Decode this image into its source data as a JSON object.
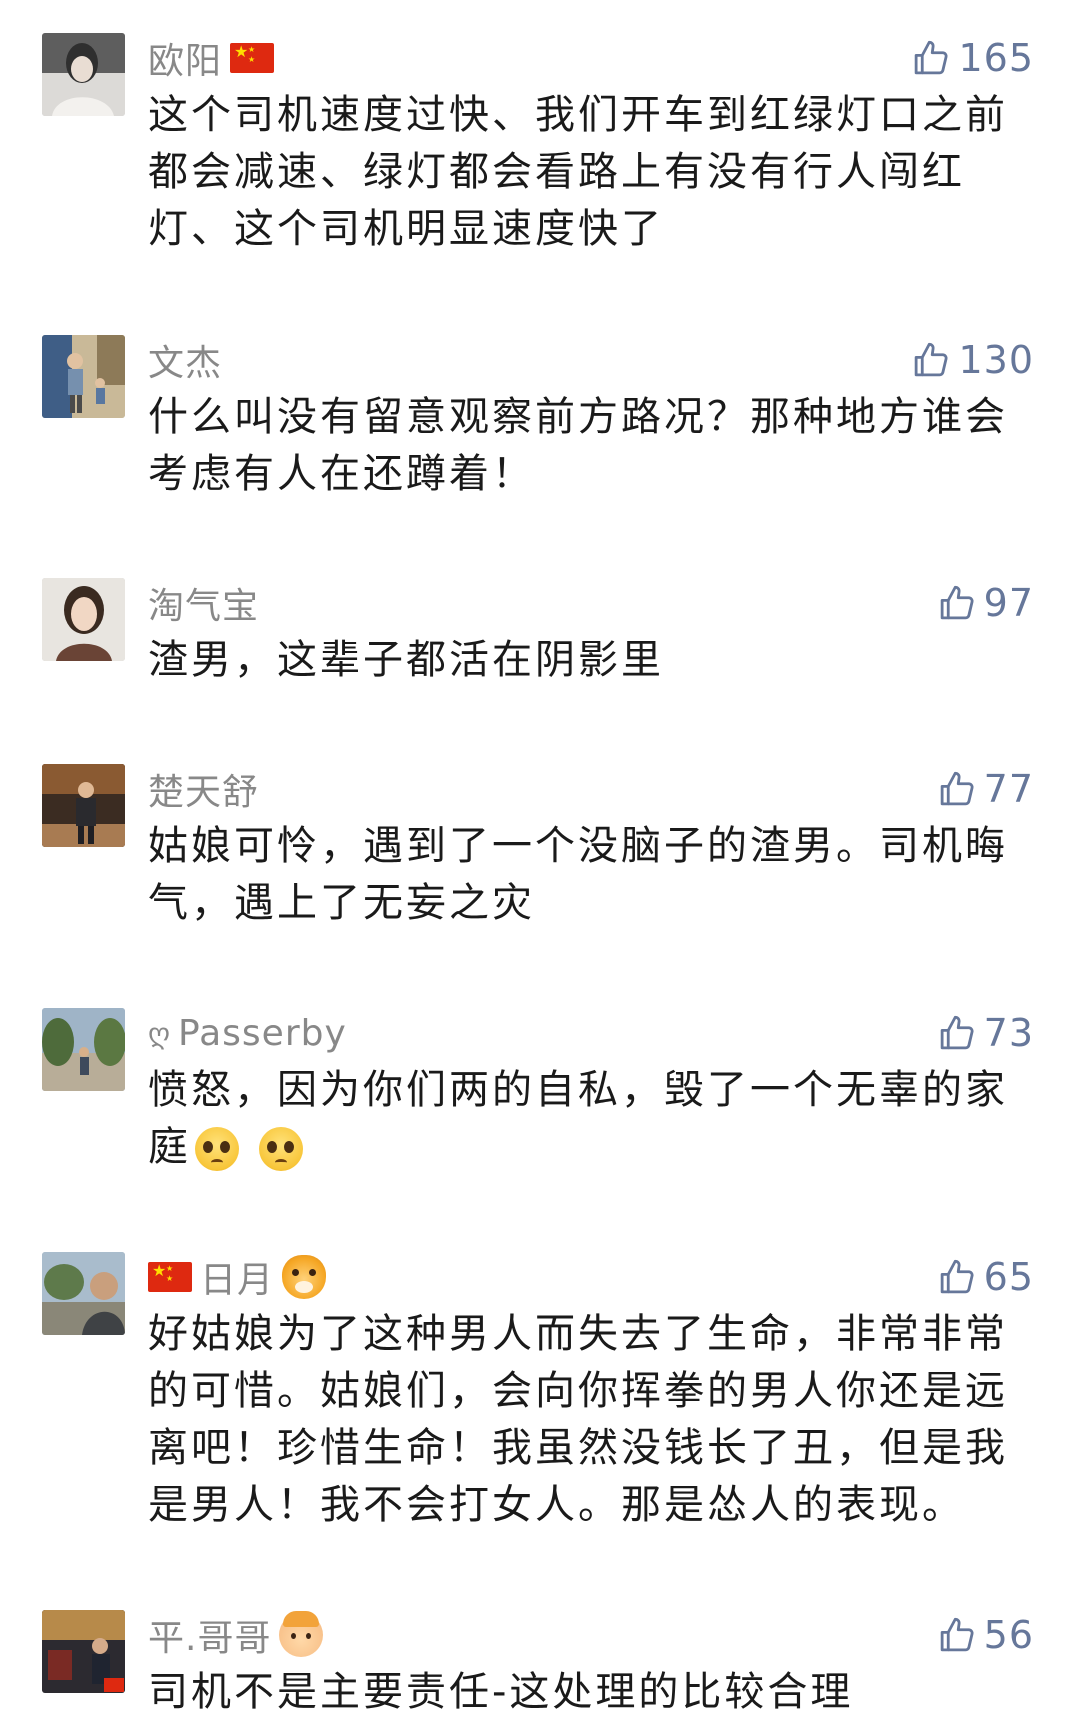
{
  "comments": [
    {
      "username": "欧阳",
      "likes": "165",
      "text": "这个司机速度过快、我们开车到红绿灯口之前都会减速、绿灯都会看路上有没有行人闯红灯、这个司机明显速度快了",
      "name_prefix_icon": "",
      "name_suffix_icon": "china-flag-icon",
      "avatar_colors": [
        "#6b6b6b",
        "#e8e6e4"
      ]
    },
    {
      "username": "文杰",
      "likes": "130",
      "text": "什么叫没有留意观察前方路况？那种地方谁会考虑有人在还蹲着！",
      "name_prefix_icon": "",
      "name_suffix_icon": "",
      "avatar_colors": [
        "#4d6b8a",
        "#c6b28c"
      ]
    },
    {
      "username": "淘气宝",
      "likes": "97",
      "text": "渣男，这辈子都活在阴影里",
      "name_prefix_icon": "",
      "name_suffix_icon": "",
      "avatar_colors": [
        "#e4e0da",
        "#7a5a45"
      ]
    },
    {
      "username": "楚天舒",
      "likes": "77",
      "text": "姑娘可怜，遇到了一个没脑子的渣男。司机晦气，遇上了无妄之灾",
      "name_prefix_icon": "",
      "name_suffix_icon": "",
      "avatar_colors": [
        "#6e4a2c",
        "#2e2a2a"
      ]
    },
    {
      "username": "Passerby",
      "likes": "73",
      "text": "愤怒，因为你们两的自私，毁了一个无辜的家庭",
      "text_trailing_emoji": [
        "pleading-face-icon",
        "pleading-face-icon"
      ],
      "name_prefix_icon": "vinyl-symbol-icon",
      "name_prefix_glyph": "ღ",
      "name_suffix_icon": "",
      "avatar_colors": [
        "#87a0b9",
        "#4e6b3b"
      ]
    },
    {
      "username": "日月",
      "likes": "65",
      "text": "好姑娘为了这种男人而失去了生命，非常非常的可惜。姑娘们，会向你挥拳的男人你还是远离吧！珍惜生命！我虽然没钱长了丑，但是我是男人！我不会打女人。那是怂人的表现。",
      "name_prefix_icon": "china-flag-icon",
      "name_suffix_icon": "tiger-face-icon",
      "avatar_colors": [
        "#9db2c8",
        "#5b5f55"
      ]
    },
    {
      "username": "平.哥哥",
      "likes": "56",
      "text": "司机不是主要责任-这处理的比较合理",
      "name_prefix_icon": "",
      "name_suffix_icon": "boy-face-icon",
      "avatar_colors": [
        "#b78a4a",
        "#2a2a35"
      ]
    }
  ]
}
